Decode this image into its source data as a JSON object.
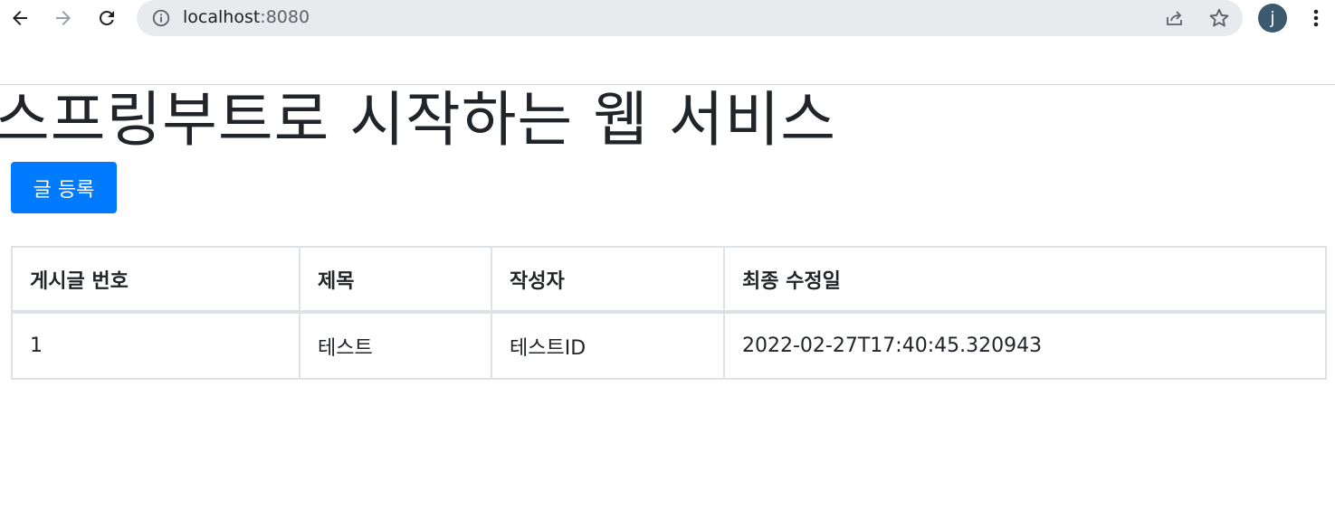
{
  "browser": {
    "url_host": "localhost",
    "url_port": ":8080",
    "profile_initial": "j"
  },
  "page": {
    "title": "스프링부트로 시작하는 웹 서비스",
    "register_button_label": "글 등록"
  },
  "table": {
    "headers": [
      "게시글 번호",
      "제목",
      "작성자",
      "최종 수정일"
    ],
    "rows": [
      [
        "1",
        "테스트",
        "테스트ID",
        "2022-02-27T17:40:45.320943"
      ]
    ]
  },
  "colors": {
    "primary": "#007bff",
    "table_border": "#dee2e6",
    "omnibox_bg": "#e8eaed",
    "avatar_bg": "#3c5a6e"
  }
}
